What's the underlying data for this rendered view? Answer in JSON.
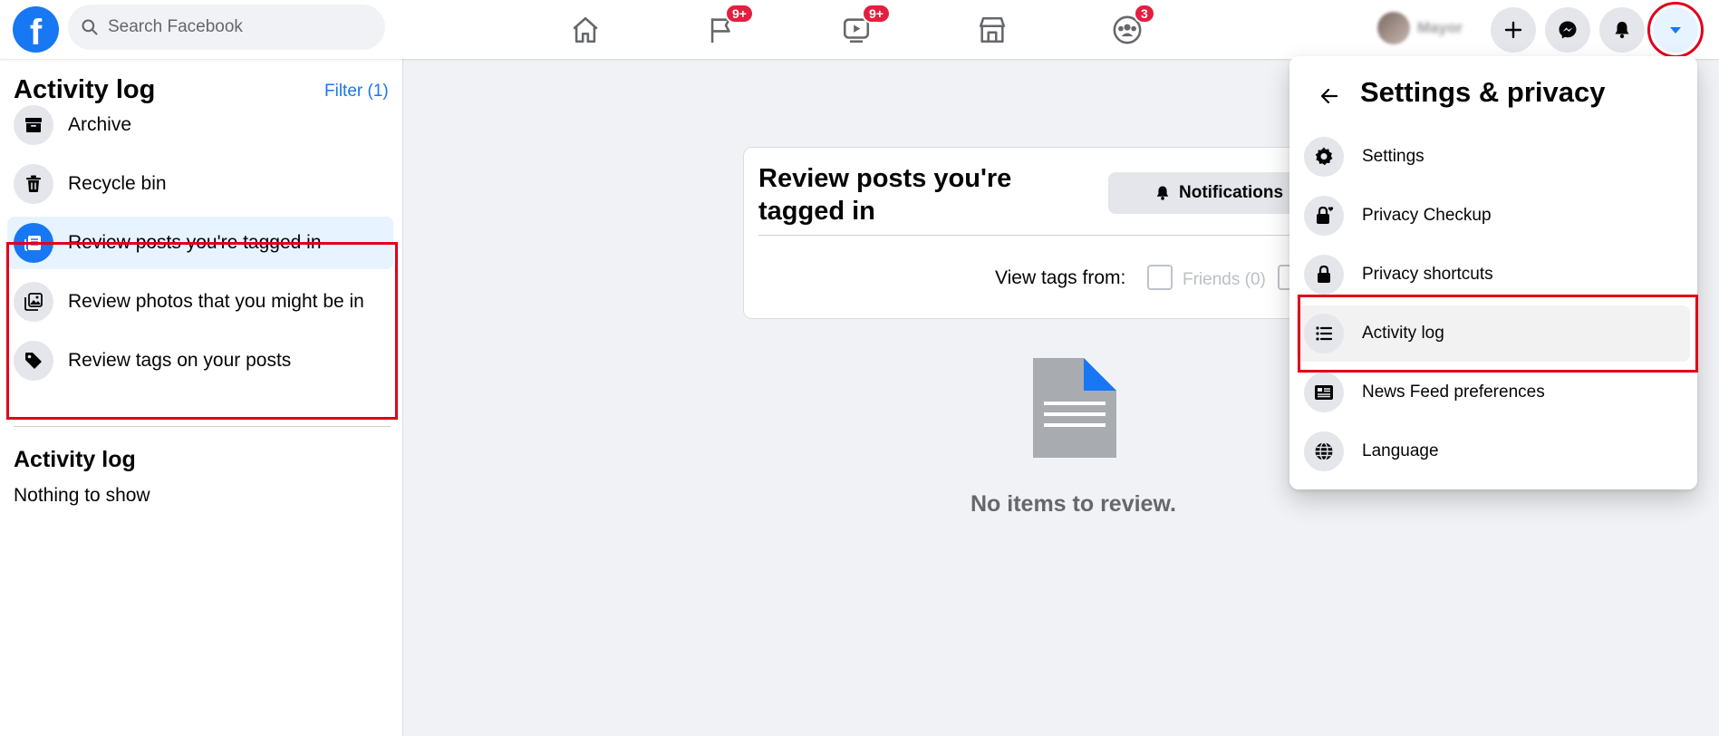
{
  "app": {
    "search_placeholder": "Search Facebook",
    "logo_letter": "f",
    "brand_color": "#1877f2",
    "badge_color": "#e41e3f",
    "highlight_color": "#e0001b"
  },
  "nav": {
    "badges": {
      "pages": "9+",
      "watch": "9+",
      "groups": "3"
    }
  },
  "profile": {
    "name": "Mayor"
  },
  "sidebar": {
    "title": "Activity log",
    "filter": "Filter (1)",
    "items": [
      {
        "label": "Archive",
        "icon": "archive-icon"
      },
      {
        "label": "Recycle bin",
        "icon": "trash-icon"
      },
      {
        "label": "Review posts you're tagged in",
        "icon": "tagged-posts-icon",
        "selected": true
      },
      {
        "label": "Review photos that you might be in",
        "icon": "photos-icon"
      },
      {
        "label": "Review tags on your posts",
        "icon": "tag-icon"
      }
    ],
    "section_title": "Activity log",
    "section_empty": "Nothing to show"
  },
  "main": {
    "card_title": "Review posts you're tagged in",
    "notifications_button": "Notifications",
    "view_tags_label": "View tags from:",
    "friends_option": "Friends (0)",
    "empty_message": "No items to review."
  },
  "dropdown": {
    "title": "Settings & privacy",
    "items": [
      {
        "label": "Settings",
        "icon": "gear-icon"
      },
      {
        "label": "Privacy Checkup",
        "icon": "lock-heart-icon"
      },
      {
        "label": "Privacy shortcuts",
        "icon": "lock-icon"
      },
      {
        "label": "Activity log",
        "icon": "list-icon",
        "highlighted": true
      },
      {
        "label": "News Feed preferences",
        "icon": "news-feed-icon"
      },
      {
        "label": "Language",
        "icon": "globe-icon"
      }
    ]
  }
}
